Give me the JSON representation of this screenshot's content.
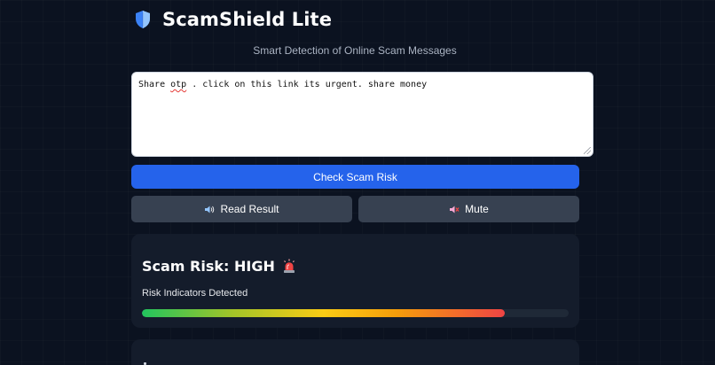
{
  "app": {
    "title": "ScamShield Lite",
    "subtitle": "Smart Detection of Online Scam Messages"
  },
  "input": {
    "text_before": "Share ",
    "text_flagged": "otp",
    "text_after": " . click on this link its urgent. share money"
  },
  "actions": {
    "check_label": "Check Scam Risk",
    "read_label": "Read Result",
    "mute_label": "Mute"
  },
  "result": {
    "risk_text": "Scam Risk: HIGH",
    "indicators_label": "Risk Indicators Detected",
    "risk_level": 0.85
  },
  "icons": {
    "logo": "shield-icon",
    "read": "speaker-icon",
    "mute": "muted-speaker-icon",
    "risk": "siren-icon"
  },
  "colors": {
    "background": "#0b1220",
    "primary_button": "#2563eb",
    "secondary_button": "#374151",
    "card": "#141c2b",
    "bar_low": "#22c55e",
    "bar_mid": "#facc15",
    "bar_high": "#ef4444"
  }
}
